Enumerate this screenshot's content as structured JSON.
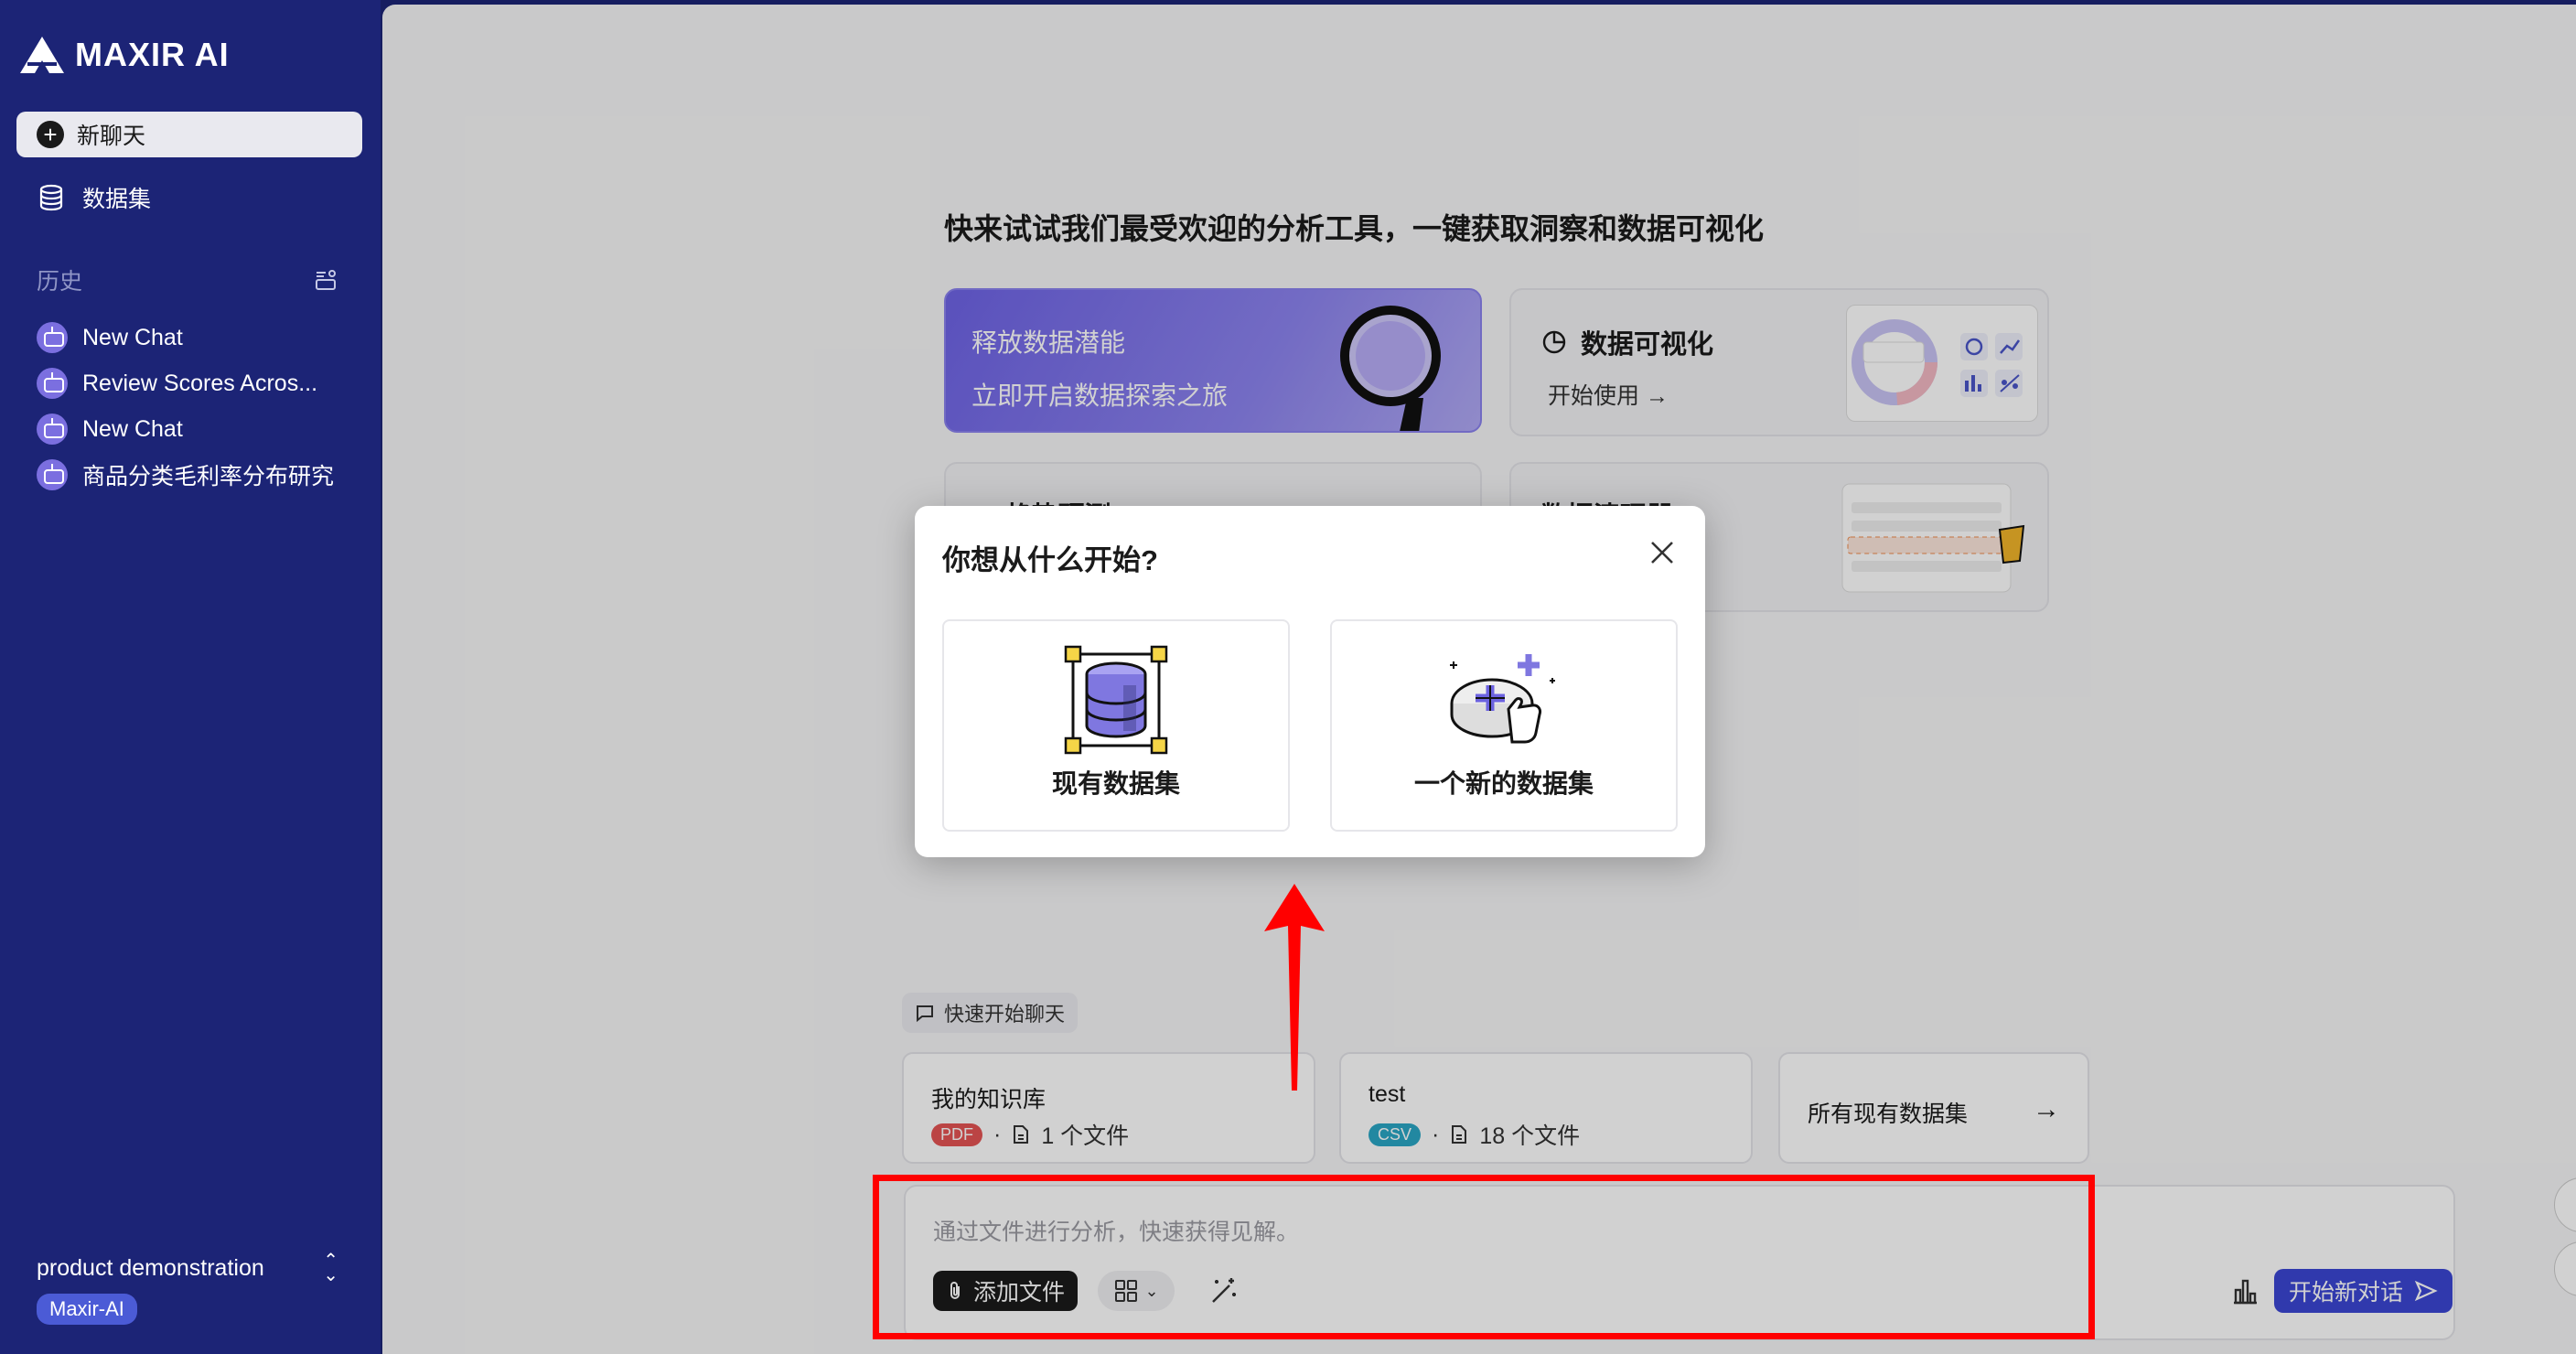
{
  "sidebar": {
    "logo_text": "MAXIR AI",
    "new_chat": "新聊天",
    "datasets": "数据集",
    "history_title": "历史",
    "history": [
      {
        "label": "New Chat"
      },
      {
        "label": "Review Scores Acros..."
      },
      {
        "label": "New Chat"
      },
      {
        "label": "商品分类毛利率分布研究"
      }
    ],
    "workspace_name": "product demonstration",
    "workspace_badge": "Maxir-AI"
  },
  "main": {
    "headline": "快来试试我们最受欢迎的分析工具，一键获取洞察和数据可视化",
    "promo": {
      "line1": "释放数据潜能",
      "line2": "立即开启数据探索之旅"
    },
    "viz_card": {
      "title": "数据可视化",
      "cta": "开始使用 →"
    },
    "card_b_title": "↗ 趋势预测",
    "card_c_title": "数据清理器",
    "quick_start": "快速开始聊天",
    "dataset_cards": [
      {
        "name": "我的知识库",
        "type": "PDF",
        "files": "1 个文件"
      },
      {
        "name": "test",
        "type": "CSV",
        "files": "18 个文件"
      }
    ],
    "all_datasets": "所有现有数据集",
    "input": {
      "placeholder": "通过文件进行分析，快速获得见解。",
      "add_file": "添加文件",
      "send": "开始新对话"
    }
  },
  "modal": {
    "title": "你想从什么开始?",
    "option_existing": "现有数据集",
    "option_new": "一个新的数据集"
  },
  "colors": {
    "sidebar_bg": "#1c2476",
    "accent": "#3b46d3",
    "annotation": "#ff0000"
  }
}
